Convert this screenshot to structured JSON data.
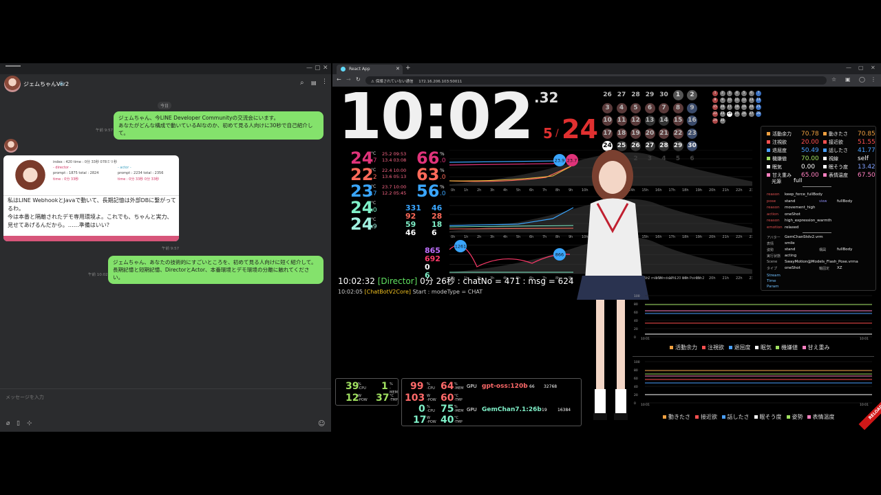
{
  "chat": {
    "title": "ジェムちゃんVer2",
    "date_divider": "今日",
    "messages": [
      {
        "text_line1": "ジェムちゃん、今LINE Developer Communityの交流会にいます。",
        "text_line2": "あなたがどんな構成で動いているAIなのか、初めて見る人向けに30秒で自己紹介して。",
        "time": "午前 9:57"
      },
      {
        "card": {
          "index_line": "index : 420  time : 0分 33秒  078ミリ秒",
          "director_label": "- director -",
          "actor_label": "- actor -",
          "dir_prompt": "prompt : 1875  total : 2824",
          "dir_time": "time : 0分 33秒",
          "act_prompt": "prompt : 2234  total : 2356",
          "act_time": "time : 0分 33秒 0分 33秒",
          "text": "私はLINE WebhookとJavaで動いて、長期記憶は外部DBに繋がってるわ。\n今は本番と隔離されたデモ専用環境よ。これでも、ちゃんと実力、見せてあげるんだから。……準備はいい？"
        },
        "time": "午前 9:57"
      },
      {
        "text_line1": "ジェムちゃん、あなたの技術的にすごいところを、初めて見る人向けに短く紹介して。",
        "text_line2": "長期記憶と短期記憶、DirectorとActor、本番環境とデモ環境の分離に触れてください。",
        "time": "午前 10:02"
      }
    ],
    "input_placeholder": "メッセージを入力"
  },
  "browser": {
    "tab_title": "React App",
    "insecure_label": "保護されていない通信",
    "url": "172.16.206.103:50011"
  },
  "dashboard": {
    "clock": {
      "time": "10:02",
      "seconds": ".32",
      "month": "5",
      "day": "24"
    },
    "calendar_rows": [
      [
        "26",
        "27",
        "28",
        "29",
        "30",
        "1",
        "2"
      ],
      [
        "3",
        "4",
        "5",
        "6",
        "7",
        "8",
        "9"
      ],
      [
        "10",
        "11",
        "12",
        "13",
        "14",
        "15",
        "16"
      ],
      [
        "17",
        "18",
        "19",
        "20",
        "21",
        "22",
        "23"
      ],
      [
        "24",
        "25",
        "26",
        "27",
        "28",
        "29",
        "30"
      ],
      [
        "31",
        "1",
        "2",
        "3",
        "4",
        "5",
        "6"
      ]
    ],
    "mini_calendar_rows": [
      [
        "1",
        "2",
        "3",
        "4",
        "5",
        "6",
        "7"
      ],
      [
        "8",
        "9",
        "10",
        "11",
        "12",
        "13",
        "14"
      ],
      [
        "15",
        "16",
        "17",
        "18",
        "19",
        "20",
        "21"
      ],
      [
        "22",
        "23",
        "24",
        "25",
        "26",
        "27",
        "28"
      ],
      [
        "29",
        "30"
      ]
    ],
    "temps": [
      {
        "v": "24",
        "d": ".7",
        "hi": "25.2 09:53",
        "lo": "13.4 03:08",
        "color": "#e0337a"
      },
      {
        "v": "22",
        "d": ".2",
        "hi": "22.4 10:00",
        "lo": "13.6 05:13",
        "color": "#ff6a5a"
      },
      {
        "v": "23",
        "d": ".7",
        "hi": "23.7 10:00",
        "lo": "12.2 05:45",
        "color": "#3aa6ff"
      },
      {
        "v": "24",
        "d": ".0",
        "color": "#7ff0c8"
      },
      {
        "v": "24",
        "d": ".9",
        "color": "#a0f0e0"
      }
    ],
    "temp_unit": "°C",
    "humid": [
      {
        "v": "66",
        "d": ".0",
        "color": "#e0337a"
      },
      {
        "v": "63",
        "d": ".0",
        "color": "#ff6a5a"
      },
      {
        "v": "56",
        "d": ".0",
        "color": "#3aa6ff"
      }
    ],
    "humid_unit": "%",
    "chart1_markers": [
      "23.9",
      "23.7"
    ],
    "chart2_left": [
      {
        "a": "331",
        "b": "46",
        "ca": "#3aa6ff",
        "cb": "#3aa6ff"
      },
      {
        "a": "92",
        "b": "28",
        "ca": "#ff6a5a",
        "cb": "#ff6a5a"
      },
      {
        "a": "59",
        "b": "18",
        "ca": "#7ff0c8",
        "cb": "#7ff0c8"
      },
      {
        "a": "46",
        "b": "6",
        "ca": "#ffffff",
        "cb": "#ffffff"
      }
    ],
    "chart3_left": [
      {
        "a": "865",
        "ca": "#c070ff"
      },
      {
        "a": "692",
        "ca": "#ff3a6a"
      },
      {
        "a": "0",
        "ca": "#ffffff"
      },
      {
        "a": "6",
        "ca": "#7ff0c8"
      }
    ],
    "chart3_markers": [
      "1261",
      "866"
    ],
    "hours": [
      "0h",
      "1h",
      "2h",
      "3h",
      "4h",
      "5h",
      "6h",
      "7h",
      "8h",
      "9h",
      "10h"
    ],
    "hours_right": [
      "14h",
      "15h",
      "16h",
      "17h",
      "18h",
      "19h",
      "20h",
      "21h",
      "22h",
      "23h"
    ],
    "status_line": "10:02:32",
    "status_director": "[Director]",
    "status_rest": "0分 26秒 : chatNo = 471 : msg = 624",
    "log_time": "10:02:05",
    "log_tag": "[ChatBotV2Core]",
    "log_text": "Start : modeType = CHAT",
    "window_info": ": 2 min  Window: 120 min  Points: 2",
    "params": [
      {
        "k": "活動余力",
        "v": "70.78",
        "c": "#f0a040"
      },
      {
        "k": "動きたさ",
        "v": "70.85",
        "c": "#f0a040"
      },
      {
        "k": "注視欲",
        "v": "20.00",
        "c": "#ff5050"
      },
      {
        "k": "接近欲",
        "v": "51.55",
        "c": "#ff5050"
      },
      {
        "k": "退屈度",
        "v": "50.49",
        "c": "#4aa0ff"
      },
      {
        "k": "話したさ",
        "v": "41.77",
        "c": "#4aa0ff"
      },
      {
        "k": "機嫌値",
        "v": "70.00",
        "c": "#a0e060"
      },
      {
        "k": "視線",
        "v": "self",
        "c": "#ffffff"
      },
      {
        "k": "眠気",
        "v": "0.00",
        "c": "#ffffff"
      },
      {
        "k": "眠そう度",
        "v": "13.42",
        "c": "#ffffff"
      },
      {
        "k": "甘え重み",
        "v": "65.00",
        "c": "#ff80c0"
      },
      {
        "k": "表情温度",
        "v": "67.50",
        "c": "#ff80c0"
      }
    ],
    "light_label": "光源",
    "light_value": "full",
    "detail_rows": [
      {
        "k": "reason",
        "v": "keep_force_fullBody"
      },
      {
        "k": "pose",
        "v": "stand",
        "k2": "view",
        "v2": "fullBody"
      },
      {
        "k": "reason",
        "v": "movement_high"
      },
      {
        "k": "action",
        "v": "oneShot"
      },
      {
        "k": "reason",
        "v": "high_expression_warmth"
      },
      {
        "k": "emotion",
        "v": "relaxed"
      }
    ],
    "avatar_rows": [
      {
        "k": "アバター",
        "v": "GemChanStdv2.vrm"
      },
      {
        "k": "表情",
        "v": "smile"
      },
      {
        "k": "姿勢",
        "v": "stand",
        "k2": "構図",
        "v2": "fullBody"
      },
      {
        "k": "実行状態",
        "v": "acting"
      },
      {
        "k": "Scene",
        "v": "SwayMotion@Models_Flash_Pose.vrma"
      },
      {
        "k": "タイプ",
        "v": "oneShot",
        "k2": "軸固定",
        "v2": "XZ"
      }
    ],
    "stream_labels": [
      "Stream",
      "Time",
      "Param"
    ],
    "legend1": [
      {
        "k": "活動余力",
        "c": "#f0a040"
      },
      {
        "k": "注視欲",
        "c": "#ff5050"
      },
      {
        "k": "退屈度",
        "c": "#4aa0ff"
      },
      {
        "k": "眠気",
        "c": "#ffffff"
      },
      {
        "k": "機嫌値",
        "c": "#a0e060"
      },
      {
        "k": "甘え重み",
        "c": "#ff80c0"
      }
    ],
    "legend2": [
      {
        "k": "動きたさ",
        "c": "#f0a040"
      },
      {
        "k": "接近欲",
        "c": "#ff5050"
      },
      {
        "k": "話したさ",
        "c": "#4aa0ff"
      },
      {
        "k": "眠そう度",
        "c": "#ffffff"
      },
      {
        "k": "姿勢",
        "c": "#a0e060"
      },
      {
        "k": "表情温度",
        "c": "#ff80c0"
      }
    ],
    "chart_y1": [
      "100",
      "80",
      "60",
      "40",
      "20",
      "0"
    ],
    "chart_x1": [
      "10:01",
      "10:01"
    ],
    "sys1": {
      "cpu": "39",
      "cpu_u": "%",
      "mem": "1",
      "pow": "12",
      "pow_u": "W",
      "tmp": "37",
      "tmp_u": "°C"
    },
    "sys2": {
      "cpu": "99",
      "mem": "64",
      "pow": "103",
      "tmp": "60",
      "cpu2": "0",
      "mem2": "75",
      "pow2": "17",
      "tmp2": "40"
    },
    "gpu1": {
      "label": "GPU",
      "model": "gpt-oss:120b",
      "a": "66",
      "b": "32768"
    },
    "gpu2": {
      "label": "GPU",
      "model": "GemChan7.1:26b",
      "a": "19",
      "b": "16384"
    },
    "reload": "RELOAD"
  }
}
